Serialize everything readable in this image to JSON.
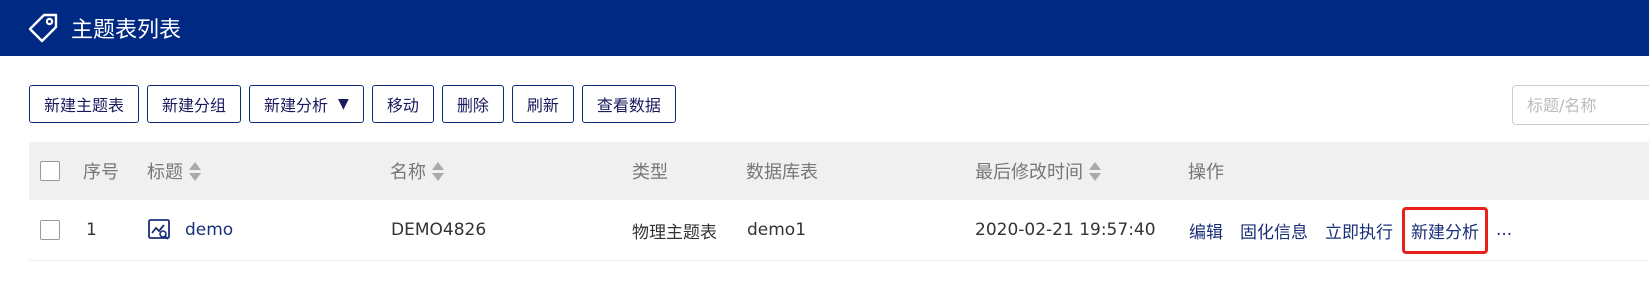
{
  "header": {
    "title": "主题表列表",
    "icon": "tag-icon",
    "bg": "#002984"
  },
  "toolbar": {
    "buttons": [
      "新建主题表",
      "新建分组",
      "新建分析",
      "移动",
      "删除",
      "刷新",
      "查看数据"
    ],
    "dropdown_caret": "▼"
  },
  "search": {
    "placeholder": "标题/名称"
  },
  "table": {
    "columns": [
      "序号",
      "标题",
      "名称",
      "类型",
      "数据库表",
      "最后修改时间",
      "操作"
    ],
    "rows": [
      {
        "index": "1",
        "title": "demo",
        "name": "DEMO4826",
        "type": "物理主题表",
        "db_table": "demo1",
        "modified": "2020-02-21 19:57:40",
        "actions": [
          "编辑",
          "固化信息",
          "立即执行",
          "新建分析"
        ],
        "more": "..."
      }
    ]
  },
  "colors": {
    "highlight": "#e8221b",
    "link": "#1a2f7a"
  }
}
